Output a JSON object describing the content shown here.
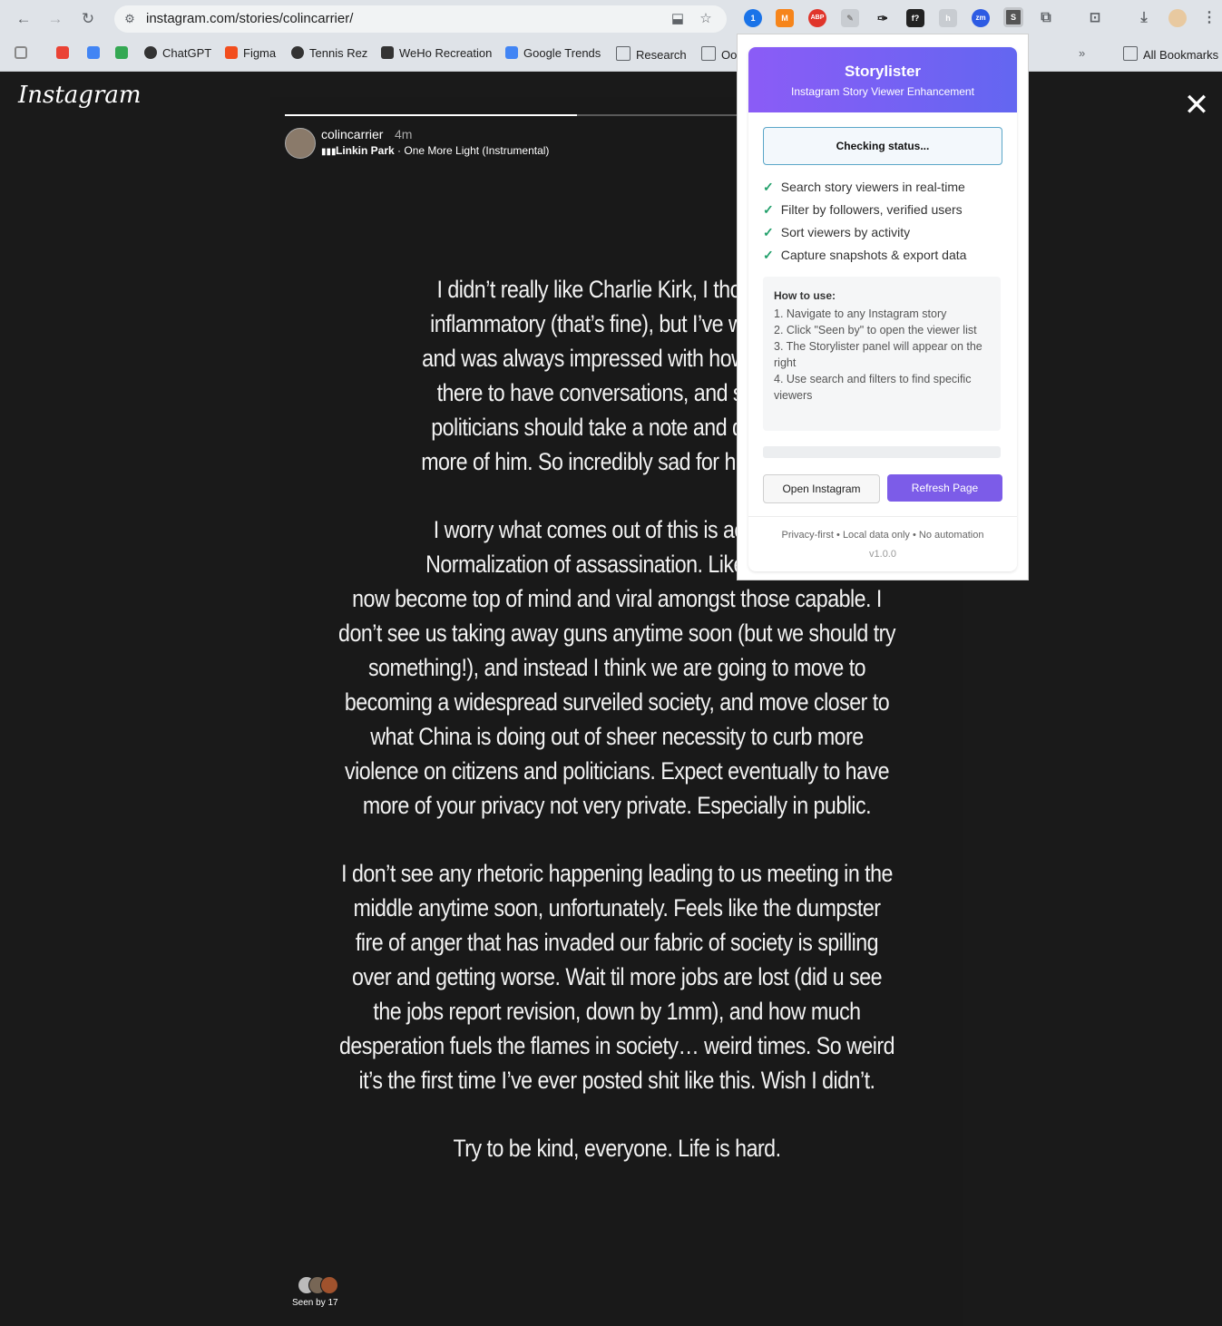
{
  "browser": {
    "url": "instagram.com/stories/colincarrier/",
    "bookmarks": [
      {
        "label": "",
        "icon": "apps-icon"
      },
      {
        "label": "",
        "icon": "gmail-icon"
      },
      {
        "label": "",
        "icon": "calendar-icon"
      },
      {
        "label": "",
        "icon": "drive-icon"
      },
      {
        "label": "ChatGPT",
        "icon": "chatgpt-icon"
      },
      {
        "label": "Figma",
        "icon": "figma-icon"
      },
      {
        "label": "Tennis Rez",
        "icon": "globe-icon"
      },
      {
        "label": "WeHo Recreation",
        "icon": "weho-icon"
      },
      {
        "label": "Google Trends",
        "icon": "trends-icon"
      },
      {
        "label": "Research",
        "icon": "folder-icon"
      },
      {
        "label": "Oo",
        "icon": "folder-icon"
      }
    ],
    "all_bookmarks": "All Bookmarks",
    "extensions": [
      "1password-icon",
      "metamask-icon",
      "adblock-icon",
      "pen-icon",
      "tool-icon",
      "formula-icon",
      "hand-icon",
      "zoom-icon",
      "storylister-icon",
      "puzzle-icon"
    ]
  },
  "instagram": {
    "logo": "Instagram",
    "story": {
      "progress": 0.44,
      "username": "colincarrier",
      "time": "4m",
      "music_artist": "Linkin Park",
      "music_track": "One More Light (Instrumental)",
      "paragraphs": [
        "I didn’t really like Charlie Kirk, I thought h\ninflammatory (that’s fine), but I’ve watched\nand was always impressed with how much I\nthere to have conversations, and show u\npoliticians should take a note and do what\nmore of him. So incredibly sad for him and h",
        "I worry what comes out of this is actually j\nNormalization of assassination. Like school\nnow become top of mind and viral amongst those capable. I\ndon’t see us taking away guns anytime soon (but we should try\nsomething!), and instead I think we are going to move to\nbecoming a widespread surveiled society, and move closer to\nwhat China is doing out of sheer necessity to curb more\nviolence on citizens and politicians. Expect eventually to have\nmore of your privacy not very private. Especially in public.",
        "I don’t see any rhetoric happening leading to us meeting in the\nmiddle anytime soon, unfortunately.  Feels like the dumpster\nfire of anger that has invaded our fabric of society is spilling\nover and getting worse. Wait til more jobs are lost (did u see\nthe jobs report revision, down by 1mm), and how much\ndesperation fuels the flames in society… weird times. So weird\nit’s the first time I’ve ever posted shit like this. Wish I didn’t.",
        "Try to be kind, everyone. Life is hard."
      ],
      "seen_by": "Seen by 17"
    }
  },
  "popup": {
    "title": "Storylister",
    "subtitle": "Instagram Story Viewer Enhancement",
    "status": "Checking status...",
    "features": [
      "Search story viewers in real-time",
      "Filter by followers, verified users",
      "Sort viewers by activity",
      "Capture snapshots & export data"
    ],
    "howto_title": "How to use:",
    "howto_steps": "1. Navigate to any Instagram story\n2. Click \"Seen by\" to open the viewer list\n3. The Storylister panel will appear on the right\n4. Use search and filters to find specific viewers",
    "btn_open": "Open Instagram",
    "btn_refresh": "Refresh Page",
    "footer": "Privacy-first • Local data only • No automation",
    "version": "v1.0.0"
  }
}
